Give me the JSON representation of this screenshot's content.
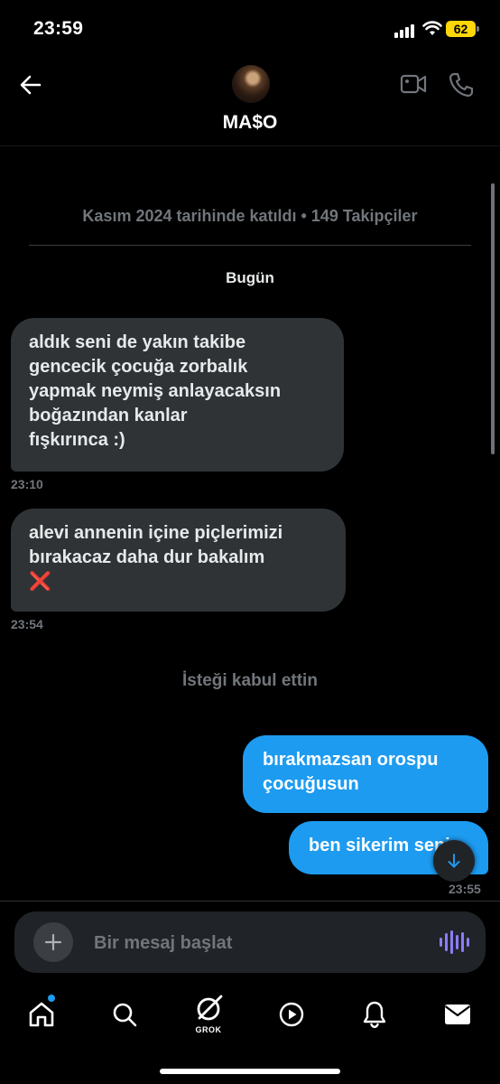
{
  "status_bar": {
    "time": "23:59",
    "battery": "62"
  },
  "header": {
    "contact_name": "MA$O"
  },
  "profile_info": {
    "joined": "Kasım 2024 tarihinde katıldı • 149 Takipçiler"
  },
  "date_label": "Bugün",
  "messages_in": [
    {
      "lines": [
        "aldık seni de yakın takibe",
        "gencecik çocuğa zorbalık",
        "yapmak neymiş anlayacaksın",
        "boğazından kanlar",
        "fışkırınca :)"
      ],
      "time": "23:10"
    },
    {
      "lines": [
        "alevi annenin içine piçlerimizi",
        "bırakacaz daha dur bakalım",
        "❌"
      ],
      "time": "23:54"
    }
  ],
  "notice": "İsteği kabul ettin",
  "messages_out": [
    {
      "lines": [
        "bırakmazsan orospu",
        "çocuğusun"
      ]
    },
    {
      "lines": [
        "ben sikerim seni"
      ],
      "time": "23:55"
    }
  ],
  "composer": {
    "placeholder": "Bir mesaj başlat"
  },
  "tabbar": {
    "grok_label": "GROK"
  },
  "colors": {
    "accent": "#1d9bf0",
    "incoming_bubble": "#2f3336",
    "muted_text": "#71767b",
    "battery": "#ffd60a"
  },
  "icons": [
    "back-arrow-icon",
    "video-call-icon",
    "phone-icon",
    "scroll-down-arrow-icon",
    "plus-icon",
    "voice-wave-icon",
    "home-icon",
    "search-icon",
    "grok-icon",
    "play-icon",
    "bell-icon",
    "mail-icon"
  ]
}
